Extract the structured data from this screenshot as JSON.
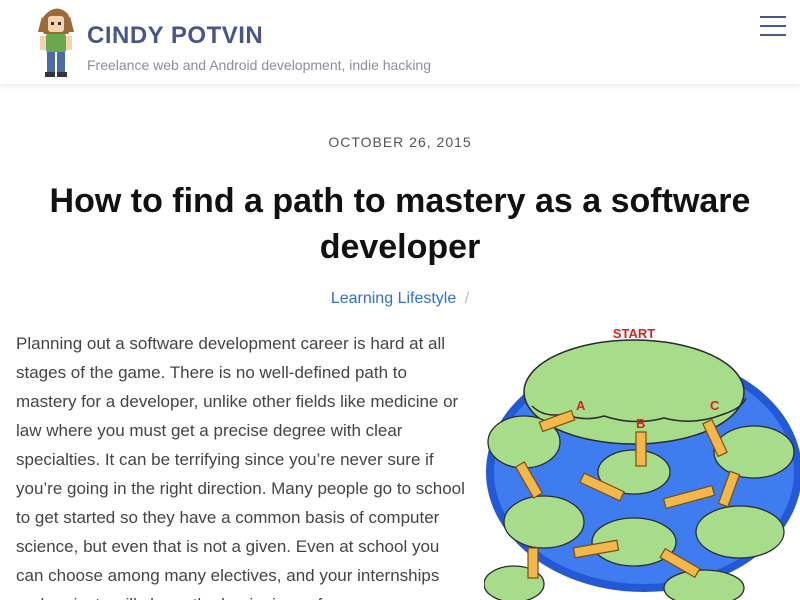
{
  "site": {
    "title": "CINDY POTVIN",
    "tagline": "Freelance web and Android development, indie hacking"
  },
  "header": {
    "menu_icon": "hamburger-icon"
  },
  "post": {
    "date": "OCTOBER 26, 2015",
    "title": "How to find a path to mastery as a software developer",
    "categories": [
      "Learning",
      "Lifestyle"
    ],
    "category_separator": "/",
    "body": "Planning out a software development career is hard at all stages of the game. There is no well-defined path to mastery for a developer, unlike other fields like medicine or law where you must get a precise degree with clear specialties. It can be terrifying since you’re never sure if you’re going in the right direction. Many people go to school to get started so they have a common basis of computer science, but even that is not a given. Even at school you can choose among many electives, and your internships and projects will shape the beginnings of",
    "image": {
      "start_label": "START",
      "path_labels": [
        "A",
        "B",
        "C"
      ]
    }
  },
  "colors": {
    "brand": "#4a5687",
    "link": "#2f6fd6",
    "island_green": "#a7dc8a",
    "water_blue": "#2459d6",
    "bridge_orange": "#f2b84b",
    "start_red": "#d8231c"
  }
}
